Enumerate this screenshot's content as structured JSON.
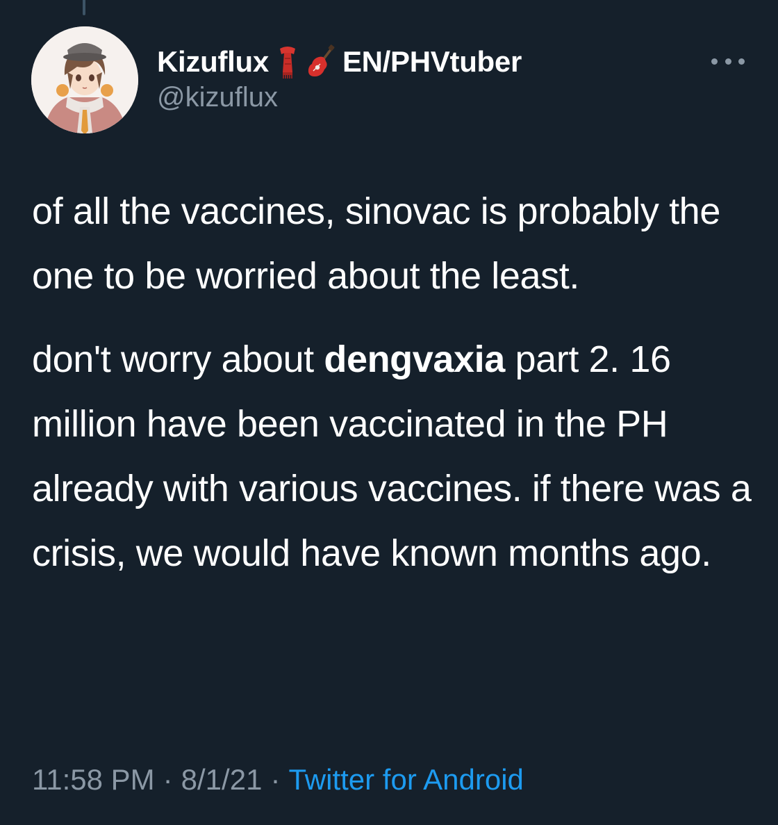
{
  "author": {
    "display_name": "Kizuflux",
    "name_suffix": "EN/PHVtuber",
    "handle": "@kizuflux",
    "name_emojis": [
      "scarf-emoji",
      "guitar-emoji"
    ],
    "avatar": "anime-character-avatar"
  },
  "tweet": {
    "paragraph1": "of all the vaccines, sinovac is probably the one to be worried about the least.",
    "paragraph2_before": "don't worry about ",
    "paragraph2_bold": "dengvaxia",
    "paragraph2_after": " part 2. 16 million have been vaccinated in the PH already with various vaccines. if there was a crisis, we would have known months ago."
  },
  "meta": {
    "time": "11:58 PM",
    "separator": "·",
    "date": "8/1/21",
    "source": "Twitter for Android"
  },
  "colors": {
    "background": "#15202b",
    "text": "#ffffff",
    "secondary": "#8b98a5",
    "link": "#1d9bf0"
  },
  "icons": {
    "more": "more-horizontal-icon"
  }
}
